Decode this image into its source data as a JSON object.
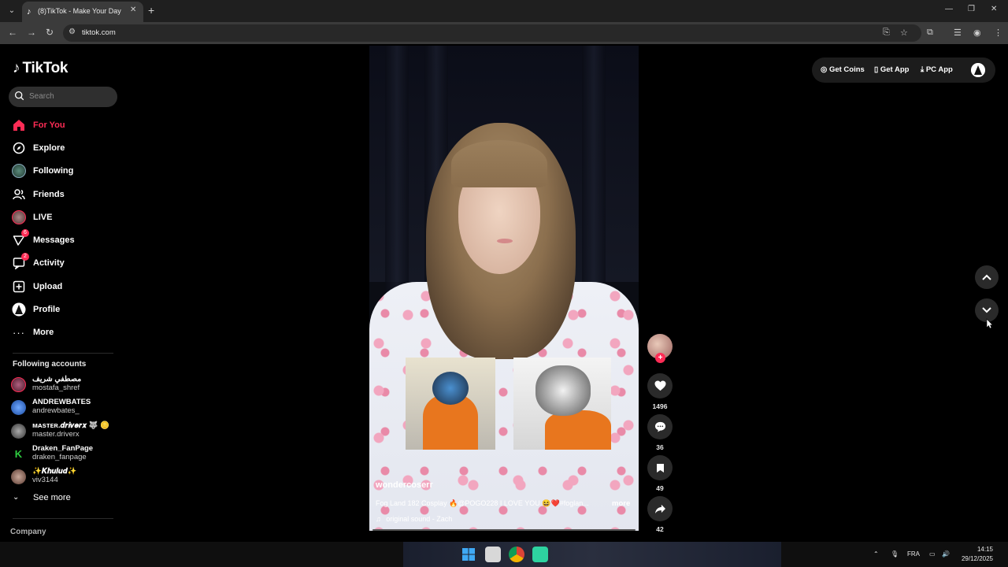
{
  "browser": {
    "tab_title": "(8)TikTok - Make Your Day",
    "url": "tiktok.com"
  },
  "sidebar": {
    "logo_text": "TikTok",
    "search_placeholder": "Search",
    "nav": [
      {
        "label": "For You",
        "icon": "home-icon",
        "active": true
      },
      {
        "label": "Explore",
        "icon": "compass-icon"
      },
      {
        "label": "Following",
        "icon": "following-avatar"
      },
      {
        "label": "Friends",
        "icon": "friends-icon"
      },
      {
        "label": "LIVE",
        "icon": "live-avatar"
      },
      {
        "label": "Messages",
        "icon": "messages-icon",
        "badge": "6"
      },
      {
        "label": "Activity",
        "icon": "activity-icon",
        "badge": "2"
      },
      {
        "label": "Upload",
        "icon": "upload-icon"
      },
      {
        "label": "Profile",
        "icon": "profile-avatar"
      },
      {
        "label": "More",
        "icon": "more-icon"
      }
    ],
    "following_title": "Following accounts",
    "accounts": [
      {
        "name": "مصطفي شريف",
        "handle": "mostafa_shref",
        "color": "#8a2a4a"
      },
      {
        "name": "ANDREWBATES",
        "handle": "andrewbates_",
        "color": "#2f6fd0"
      },
      {
        "name": "ᴍᴀsᴛᴇʀ.𝒅𝒓𝒊𝒗𝒆𝒓𝒙 🐺 🪙",
        "handle": "master.driverx",
        "color": "#6a6a6a"
      },
      {
        "name": "Draken_FanPage",
        "handle": "draken_fanpage",
        "color": "#1e9b3a"
      },
      {
        "name": "✨𝑲𝒉𝒖𝒍𝒖𝒅✨",
        "handle": "viv3144",
        "color": "#7a5a4a"
      }
    ],
    "see_more": "See more",
    "company": "Company"
  },
  "video": {
    "username": "wondercoserr",
    "caption": "Fog Land 182 Cosplay 🔥@POGO228  I LOVE YOU 😆❤️#foglan...",
    "more": "more",
    "sound": "original sound - Zach"
  },
  "actions": {
    "likes": "1496",
    "comments": "36",
    "saves": "49",
    "shares": "42"
  },
  "topbar": {
    "get_coins": "Get Coins",
    "get_app": "Get App",
    "pc_app": "PC App"
  },
  "taskbar": {
    "lang": "FRA",
    "time": "14:15",
    "date": "29/12/2025"
  },
  "colors": {
    "accent": "#fe2c55",
    "background": "#000000"
  }
}
